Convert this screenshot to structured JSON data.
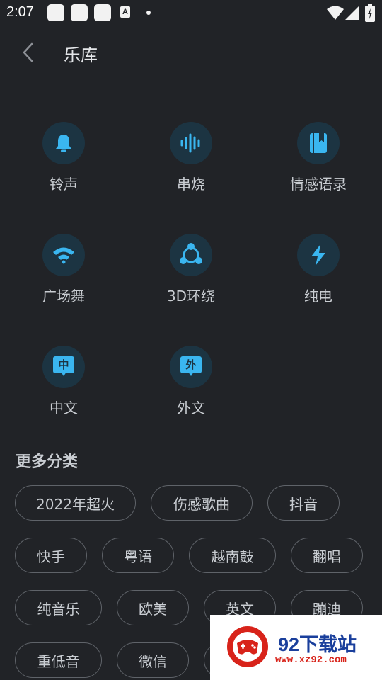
{
  "status_bar": {
    "time": "2:07",
    "notif_a": "A"
  },
  "header": {
    "title": "乐库"
  },
  "categories": [
    {
      "label": "铃声",
      "icon": "bell-icon"
    },
    {
      "label": "串烧",
      "icon": "soundwave-icon"
    },
    {
      "label": "情感语录",
      "icon": "notebook-icon"
    },
    {
      "label": "广场舞",
      "icon": "wifi-fan-icon"
    },
    {
      "label": "3D环绕",
      "icon": "surround-icon"
    },
    {
      "label": "纯电",
      "icon": "lightning-icon"
    },
    {
      "label": "中文",
      "icon": "chinese-icon",
      "glyph": "中"
    },
    {
      "label": "外文",
      "icon": "foreign-icon",
      "glyph": "外"
    }
  ],
  "more": {
    "title": "更多分类",
    "tags": [
      "2022年超火",
      "伤感歌曲",
      "抖音",
      "快手",
      "粤语",
      "越南鼓",
      "翻唱",
      "纯音乐",
      "欧美",
      "英文",
      "蹦迪",
      "重低音",
      "微信"
    ]
  },
  "watermark": {
    "text": "92下载站",
    "url": "www.xz92.com"
  },
  "colors": {
    "background": "#212327",
    "accent": "#3ab6f0",
    "icon_bg": "#1c3442",
    "text": "#c9cdd2",
    "watermark_red": "#d8231a",
    "watermark_blue": "#1a3f9c"
  }
}
